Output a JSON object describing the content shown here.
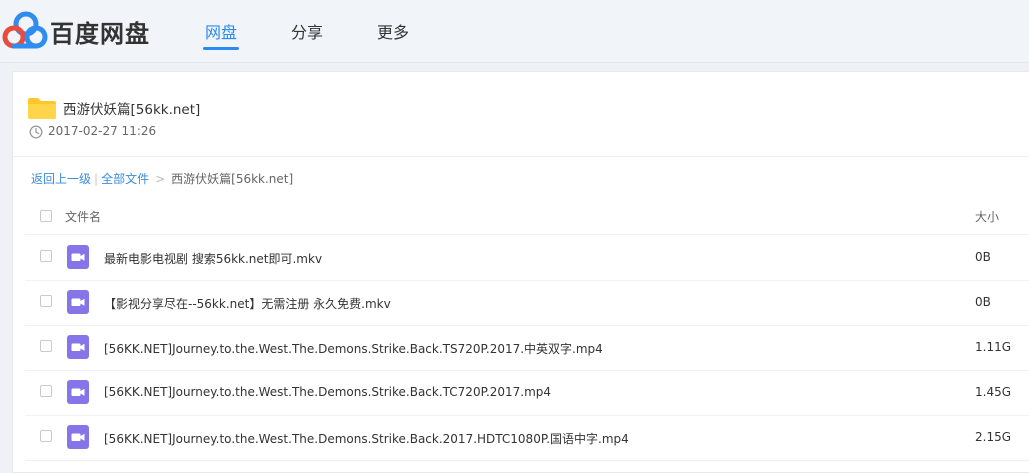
{
  "brand": {
    "name": "百度网盘"
  },
  "nav": [
    {
      "label": "网盘",
      "active": true
    },
    {
      "label": "分享",
      "active": false
    },
    {
      "label": "更多",
      "active": false
    }
  ],
  "share": {
    "title": "西游伏妖篇[56kk.net]",
    "date": "2017-02-27 11:26"
  },
  "breadcrumb": {
    "back": "返回上一级",
    "separator": "|",
    "all_files": "全部文件",
    "arrow": ">",
    "current": "西游伏妖篇[56kk.net]"
  },
  "table": {
    "col_name": "文件名",
    "col_size": "大小",
    "rows": [
      {
        "name": "最新电影电视剧 搜索56kk.net即可.mkv",
        "size": "0B"
      },
      {
        "name": "【影视分享尽在--56kk.net】无需注册 永久免费.mkv",
        "size": "0B"
      },
      {
        "name": "[56KK.NET]Journey.to.the.West.The.Demons.Strike.Back.TS720P.2017.中英双字.mp4",
        "size": "1.11G"
      },
      {
        "name": "[56KK.NET]Journey.to.the.West.The.Demons.Strike.Back.TC720P.2017.mp4",
        "size": "1.45G"
      },
      {
        "name": "[56KK.NET]Journey.to.the.West.The.Demons.Strike.Back.2017.HDTC1080P.国语中字.mp4",
        "size": "2.15G"
      }
    ]
  },
  "icons": {
    "logo": "baidu-cloud-logo-icon",
    "folder": "folder-icon",
    "clock": "clock-icon",
    "video": "video-file-icon"
  },
  "colors": {
    "accent": "#2b8bf3",
    "link": "#3b8cde",
    "folder": "#ffc72a",
    "video_icon": "#8675e8"
  }
}
